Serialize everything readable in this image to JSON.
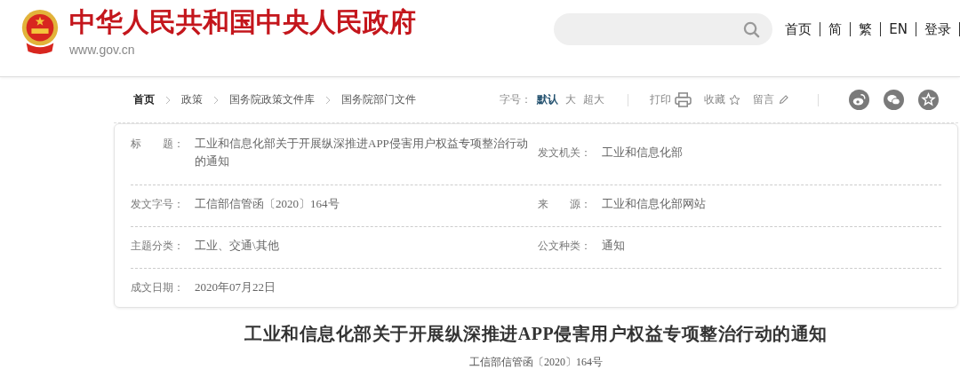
{
  "header": {
    "site_title": "中华人民共和国中央人民政府",
    "site_url": "www.gov.cn",
    "nav": [
      "首页",
      "简",
      "繁",
      "EN",
      "登录"
    ]
  },
  "breadcrumb": [
    "首页",
    "政策",
    "国务院政策文件库",
    "国务院部门文件"
  ],
  "font_size": {
    "label": "字号：",
    "options": [
      {
        "label": "默认",
        "selected": true
      },
      {
        "label": "大",
        "selected": false
      },
      {
        "label": "超大",
        "selected": false
      }
    ]
  },
  "tools": [
    {
      "kind": "print",
      "label": "打印"
    },
    {
      "kind": "favorite",
      "label": "收藏"
    },
    {
      "kind": "comment",
      "label": "留言"
    }
  ],
  "share": [
    {
      "kind": "weibo"
    },
    {
      "kind": "wechat"
    },
    {
      "kind": "favorite"
    }
  ],
  "info": [
    {
      "cells": [
        {
          "label": "标　　题：",
          "value": "工业和信息化部关于开展纵深推进APP侵害用户权益专项整治行动的通知"
        },
        {
          "label": "发文机关：",
          "value": "工业和信息化部"
        }
      ]
    },
    {
      "cells": [
        {
          "label": "发文字号：",
          "value": "工信部信管函〔2020〕164号"
        },
        {
          "label": "来　　源：",
          "value": "工业和信息化部网站"
        }
      ]
    },
    {
      "cells": [
        {
          "label": "主题分类：",
          "value": "工业、交通\\其他"
        },
        {
          "label": "公文种类：",
          "value": "通知"
        }
      ]
    },
    {
      "cells": [
        {
          "label": "成文日期：",
          "value": "2020年07月22日"
        }
      ]
    }
  ],
  "article": {
    "title": "工业和信息化部关于开展纵深推进APP侵害用户权益专项整治行动的通知",
    "doc_number": "工信部信管函〔2020〕164号"
  }
}
